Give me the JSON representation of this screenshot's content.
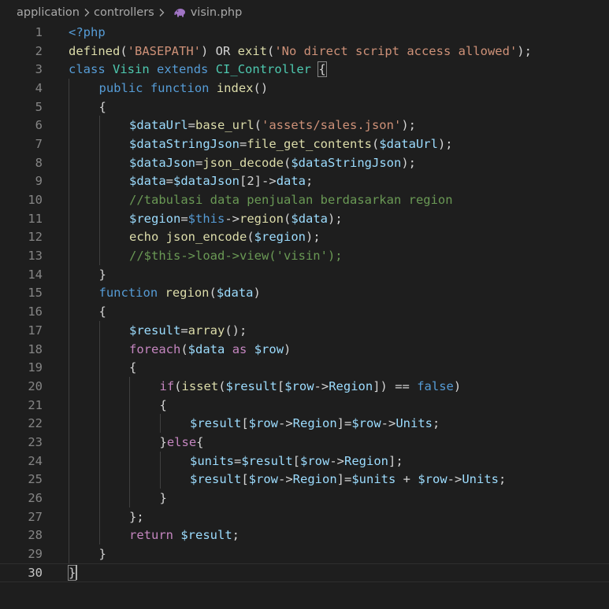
{
  "breadcrumb": {
    "items": [
      "application",
      "controllers",
      "visin.php"
    ],
    "file_icon": "php-elephant-icon"
  },
  "editor": {
    "current_line": 30,
    "colors": {
      "background": "#1e1e1e",
      "keyword": "#569cd6",
      "control": "#c586c0",
      "function": "#dcdcaa",
      "variable": "#9cdcfe",
      "string": "#ce9178",
      "comment": "#6a9955",
      "class": "#4ec9b0",
      "text": "#d4d4d4",
      "line_number": "#858585"
    },
    "lines": [
      {
        "n": 1,
        "indent": 0,
        "tokens": [
          [
            "kw",
            "<?php"
          ]
        ]
      },
      {
        "n": 2,
        "indent": 0,
        "tokens": [
          [
            "fn",
            "defined"
          ],
          [
            "plain",
            "("
          ],
          [
            "str",
            "'BASEPATH'"
          ],
          [
            "plain",
            ") OR "
          ],
          [
            "fn",
            "exit"
          ],
          [
            "plain",
            "("
          ],
          [
            "str",
            "'No direct script access allowed'"
          ],
          [
            "plain",
            ");"
          ]
        ]
      },
      {
        "n": 3,
        "indent": 0,
        "tokens": [
          [
            "kw",
            "class"
          ],
          [
            "plain",
            " "
          ],
          [
            "cls",
            "Visin"
          ],
          [
            "plain",
            " "
          ],
          [
            "kw",
            "extends"
          ],
          [
            "plain",
            " "
          ],
          [
            "cls",
            "CI_Controller"
          ],
          [
            "plain",
            " "
          ],
          [
            "box",
            "{"
          ]
        ]
      },
      {
        "n": 4,
        "indent": 1,
        "tokens": [
          [
            "kw",
            "public"
          ],
          [
            "plain",
            " "
          ],
          [
            "kw",
            "function"
          ],
          [
            "plain",
            " "
          ],
          [
            "fn",
            "index"
          ],
          [
            "plain",
            "()"
          ]
        ]
      },
      {
        "n": 5,
        "indent": 1,
        "tokens": [
          [
            "plain",
            "{"
          ]
        ]
      },
      {
        "n": 6,
        "indent": 2,
        "tokens": [
          [
            "var",
            "$dataUrl"
          ],
          [
            "plain",
            "="
          ],
          [
            "fn",
            "base_url"
          ],
          [
            "plain",
            "("
          ],
          [
            "str",
            "'assets/sales.json'"
          ],
          [
            "plain",
            ");"
          ]
        ]
      },
      {
        "n": 7,
        "indent": 2,
        "tokens": [
          [
            "var",
            "$dataStringJson"
          ],
          [
            "plain",
            "="
          ],
          [
            "fn",
            "file_get_contents"
          ],
          [
            "plain",
            "("
          ],
          [
            "var",
            "$dataUrl"
          ],
          [
            "plain",
            ");"
          ]
        ]
      },
      {
        "n": 8,
        "indent": 2,
        "tokens": [
          [
            "var",
            "$dataJson"
          ],
          [
            "plain",
            "="
          ],
          [
            "fn",
            "json_decode"
          ],
          [
            "plain",
            "("
          ],
          [
            "var",
            "$dataStringJson"
          ],
          [
            "plain",
            ");"
          ]
        ]
      },
      {
        "n": 9,
        "indent": 2,
        "tokens": [
          [
            "var",
            "$data"
          ],
          [
            "plain",
            "="
          ],
          [
            "var",
            "$dataJson"
          ],
          [
            "plain",
            "[2]->"
          ],
          [
            "var",
            "data"
          ],
          [
            "plain",
            ";"
          ]
        ]
      },
      {
        "n": 10,
        "indent": 2,
        "tokens": [
          [
            "com",
            "//tabulasi data penjualan berdasarkan region"
          ]
        ]
      },
      {
        "n": 11,
        "indent": 2,
        "tokens": [
          [
            "var",
            "$region"
          ],
          [
            "plain",
            "="
          ],
          [
            "kw",
            "$this"
          ],
          [
            "plain",
            "->"
          ],
          [
            "fn",
            "region"
          ],
          [
            "plain",
            "("
          ],
          [
            "var",
            "$data"
          ],
          [
            "plain",
            ");"
          ]
        ]
      },
      {
        "n": 12,
        "indent": 2,
        "tokens": [
          [
            "fn",
            "echo"
          ],
          [
            "plain",
            " "
          ],
          [
            "fn",
            "json_encode"
          ],
          [
            "plain",
            "("
          ],
          [
            "var",
            "$region"
          ],
          [
            "plain",
            ");"
          ]
        ]
      },
      {
        "n": 13,
        "indent": 2,
        "tokens": [
          [
            "com",
            "//$this->load->view('visin');"
          ]
        ]
      },
      {
        "n": 14,
        "indent": 1,
        "tokens": [
          [
            "plain",
            "}"
          ]
        ]
      },
      {
        "n": 15,
        "indent": 1,
        "tokens": [
          [
            "kw",
            "function"
          ],
          [
            "plain",
            " "
          ],
          [
            "fn",
            "region"
          ],
          [
            "plain",
            "("
          ],
          [
            "var",
            "$data"
          ],
          [
            "plain",
            ")"
          ]
        ]
      },
      {
        "n": 16,
        "indent": 1,
        "tokens": [
          [
            "plain",
            "{"
          ]
        ]
      },
      {
        "n": 17,
        "indent": 2,
        "tokens": [
          [
            "var",
            "$result"
          ],
          [
            "plain",
            "="
          ],
          [
            "fn",
            "array"
          ],
          [
            "plain",
            "();"
          ]
        ]
      },
      {
        "n": 18,
        "indent": 2,
        "tokens": [
          [
            "ctrl",
            "foreach"
          ],
          [
            "plain",
            "("
          ],
          [
            "var",
            "$data"
          ],
          [
            "plain",
            " "
          ],
          [
            "ctrl",
            "as"
          ],
          [
            "plain",
            " "
          ],
          [
            "var",
            "$row"
          ],
          [
            "plain",
            ")"
          ]
        ]
      },
      {
        "n": 19,
        "indent": 2,
        "tokens": [
          [
            "plain",
            "{"
          ]
        ]
      },
      {
        "n": 20,
        "indent": 3,
        "tokens": [
          [
            "ctrl",
            "if"
          ],
          [
            "plain",
            "("
          ],
          [
            "fn",
            "isset"
          ],
          [
            "plain",
            "("
          ],
          [
            "var",
            "$result"
          ],
          [
            "plain",
            "["
          ],
          [
            "var",
            "$row"
          ],
          [
            "plain",
            "->"
          ],
          [
            "var",
            "Region"
          ],
          [
            "plain",
            "]) == "
          ],
          [
            "kw",
            "false"
          ],
          [
            "plain",
            ")"
          ]
        ]
      },
      {
        "n": 21,
        "indent": 3,
        "tokens": [
          [
            "plain",
            "{"
          ]
        ]
      },
      {
        "n": 22,
        "indent": 4,
        "tokens": [
          [
            "var",
            "$result"
          ],
          [
            "plain",
            "["
          ],
          [
            "var",
            "$row"
          ],
          [
            "plain",
            "->"
          ],
          [
            "var",
            "Region"
          ],
          [
            "plain",
            "]="
          ],
          [
            "var",
            "$row"
          ],
          [
            "plain",
            "->"
          ],
          [
            "var",
            "Units"
          ],
          [
            "plain",
            ";"
          ]
        ]
      },
      {
        "n": 23,
        "indent": 3,
        "tokens": [
          [
            "plain",
            "}"
          ],
          [
            "ctrl",
            "else"
          ],
          [
            "plain",
            "{"
          ]
        ]
      },
      {
        "n": 24,
        "indent": 4,
        "tokens": [
          [
            "var",
            "$units"
          ],
          [
            "plain",
            "="
          ],
          [
            "var",
            "$result"
          ],
          [
            "plain",
            "["
          ],
          [
            "var",
            "$row"
          ],
          [
            "plain",
            "->"
          ],
          [
            "var",
            "Region"
          ],
          [
            "plain",
            "];"
          ]
        ]
      },
      {
        "n": 25,
        "indent": 4,
        "tokens": [
          [
            "var",
            "$result"
          ],
          [
            "plain",
            "["
          ],
          [
            "var",
            "$row"
          ],
          [
            "plain",
            "->"
          ],
          [
            "var",
            "Region"
          ],
          [
            "plain",
            "]="
          ],
          [
            "var",
            "$units"
          ],
          [
            "plain",
            " + "
          ],
          [
            "var",
            "$row"
          ],
          [
            "plain",
            "->"
          ],
          [
            "var",
            "Units"
          ],
          [
            "plain",
            ";"
          ]
        ]
      },
      {
        "n": 26,
        "indent": 3,
        "tokens": [
          [
            "plain",
            "}"
          ]
        ]
      },
      {
        "n": 27,
        "indent": 2,
        "tokens": [
          [
            "plain",
            "};"
          ]
        ]
      },
      {
        "n": 28,
        "indent": 2,
        "tokens": [
          [
            "ctrl",
            "return"
          ],
          [
            "plain",
            " "
          ],
          [
            "var",
            "$result"
          ],
          [
            "plain",
            ";"
          ]
        ]
      },
      {
        "n": 29,
        "indent": 1,
        "tokens": [
          [
            "plain",
            "}"
          ]
        ]
      },
      {
        "n": 30,
        "indent": 0,
        "tokens": [
          [
            "box",
            "}"
          ],
          [
            "cursor",
            ""
          ]
        ]
      }
    ]
  }
}
